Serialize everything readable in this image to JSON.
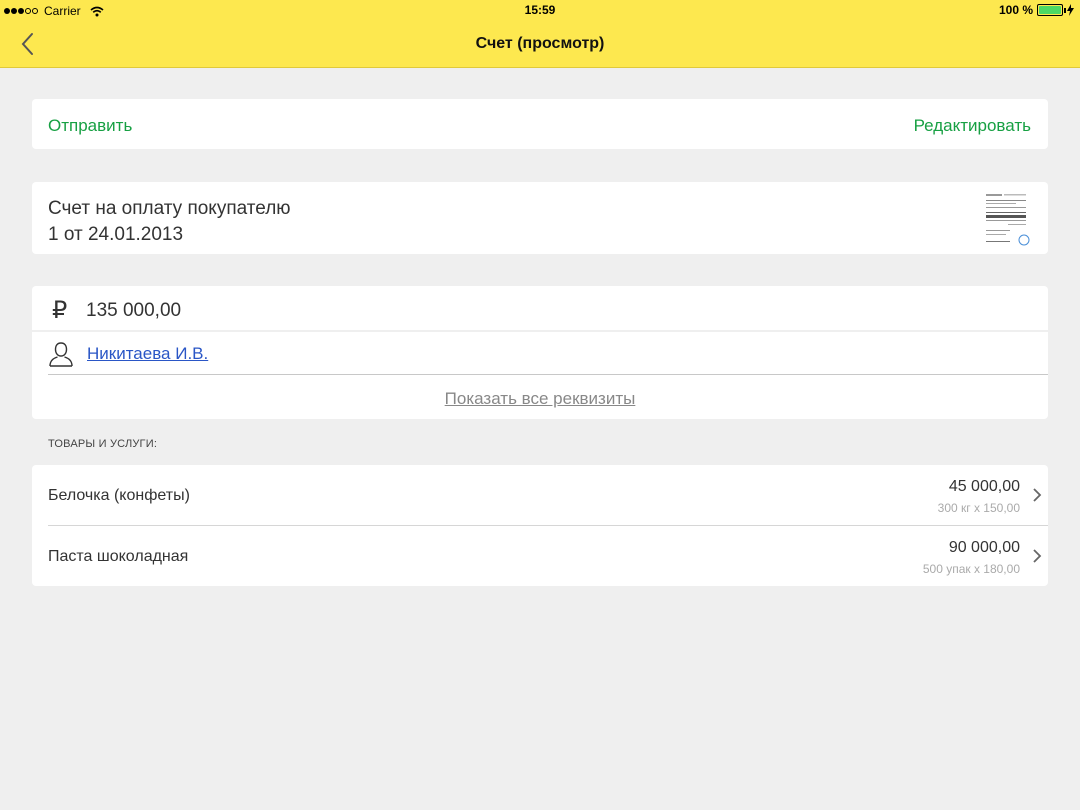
{
  "status_bar": {
    "carrier": "Carrier",
    "time": "15:59",
    "battery": "100 %"
  },
  "nav": {
    "title": "Счет (просмотр)",
    "back_icon": "chevron-left-icon"
  },
  "actions": {
    "send_label": "Отправить",
    "edit_label": "Редактировать"
  },
  "document": {
    "title_line1": "Счет на оплату покупателю",
    "title_line2": "1 от 24.01.2013"
  },
  "details": {
    "currency_symbol": "₽",
    "amount": "135 000,00",
    "person": "Никитаева И.В.",
    "show_all_label": "Показать все реквизиты"
  },
  "section": {
    "goods_label": "ТОВАРЫ И УСЛУГИ:"
  },
  "items": [
    {
      "name": "Белочка (конфеты)",
      "sum": "45 000,00",
      "detail": "300 кг х 150,00"
    },
    {
      "name": "Паста шоколадная",
      "sum": "90 000,00",
      "detail": "500 упак х 180,00"
    }
  ],
  "colors": {
    "topbar": "#fde84f",
    "accent_green": "#17a043",
    "link_blue": "#2a56c6",
    "background": "#efefef"
  }
}
